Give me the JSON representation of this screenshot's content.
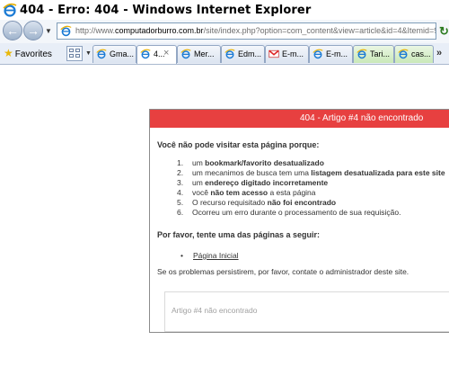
{
  "window": {
    "title": "404 - Erro: 404 - Windows Internet Explorer"
  },
  "address_bar": {
    "url_prefix": "http://www.",
    "url_domain": "computadorburro.com.br",
    "url_path": "/site/index.php?option=com_content&view=article&id=4&Itemid=9"
  },
  "favorites_bar": {
    "favorites_label": "Favorites",
    "more": "»",
    "tabs": [
      {
        "label": "Gma..."
      },
      {
        "label": "4...",
        "close": "×"
      },
      {
        "label": "Mer..."
      },
      {
        "label": "Edm..."
      },
      {
        "label": "E-m..."
      },
      {
        "label": "E-m..."
      },
      {
        "label": "Tari..."
      },
      {
        "label": "cas..."
      }
    ]
  },
  "page": {
    "header": "404 - Artigo #4 não encontrado",
    "intro": "Você não pode visitar esta página porque:",
    "reasons": [
      {
        "num": "1.",
        "pre": "um ",
        "bold": "bookmark/favorito desatualizado",
        "post": ""
      },
      {
        "num": "2.",
        "pre": "um mecanimos de busca tem uma ",
        "bold": "listagem desatualizada para este site",
        "post": ""
      },
      {
        "num": "3.",
        "pre": "um ",
        "bold": "endereço digitado incorretamente",
        "post": ""
      },
      {
        "num": "4.",
        "pre": "você ",
        "bold": "não tem acesso",
        "post": " a esta página"
      },
      {
        "num": "5.",
        "pre": "O recurso requisitado ",
        "bold": "não foi encontrado",
        "post": ""
      },
      {
        "num": "6.",
        "pre": "Ocorreu um erro durante o processamento de sua requisição.",
        "bold": "",
        "post": ""
      }
    ],
    "try_heading": "Por favor, tente uma das páginas a seguir:",
    "bullet": "•",
    "home_link": "Página Inicial",
    "contact_note": "Se os problemas persistirem, por favor, contate o administrador deste site.",
    "box_text": "Artigo #4 não encontrado"
  },
  "colors": {
    "error_header": "#e74040",
    "address_border": "#7f9db9"
  }
}
